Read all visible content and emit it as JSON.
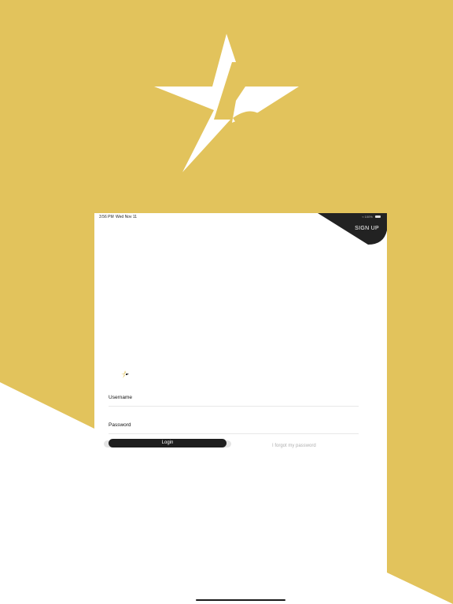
{
  "colors": {
    "brand_gold": "#e2c35c",
    "dark": "#222222",
    "white": "#ffffff",
    "muted_text": "#b0b0b0"
  },
  "icons": {
    "hero": "star-five-logo-icon",
    "small": "star-five-logo-icon",
    "battery": "battery-icon"
  },
  "status_bar": {
    "time": "3:56 PM",
    "date": "Wed Nov 11",
    "signal": "≈ 100%"
  },
  "header": {
    "signup_label": "SIGN UP"
  },
  "form": {
    "username_label": "Username",
    "username_value": "",
    "password_label": "Password",
    "password_value": "",
    "login_label": "Login",
    "forgot_label": "I forgot my password"
  }
}
